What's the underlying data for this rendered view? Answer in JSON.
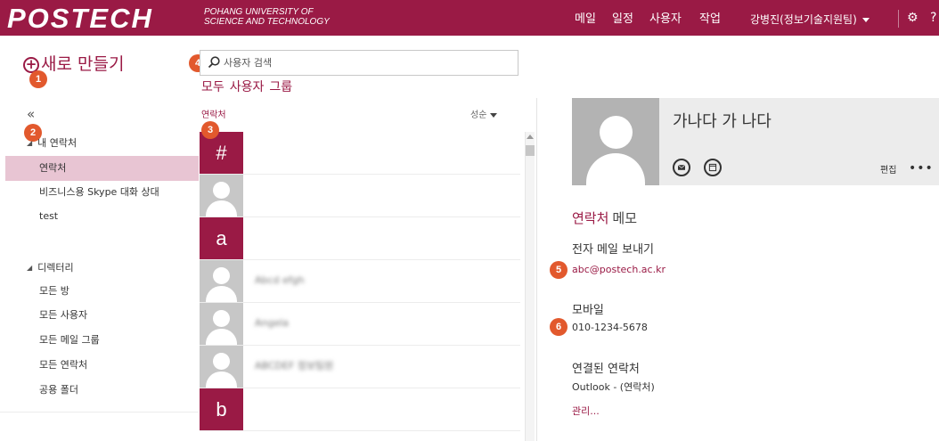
{
  "header": {
    "logo": "POSTECH",
    "logo_sub_line1": "POHANG UNIVERSITY OF",
    "logo_sub_line2": "SCIENCE AND TECHNOLOGY",
    "nav": [
      "메일",
      "일정",
      "사용자",
      "작업"
    ],
    "user": "강병진(정보기술지원팀)",
    "colors": {
      "brand": "#9a1a45"
    }
  },
  "left": {
    "new_button": "새로 만들기",
    "collapse_glyph": "«",
    "my_contacts_header": "내 연락처",
    "my_contacts": [
      "연락처",
      "비즈니스용 Skype 대화 상대",
      "test"
    ],
    "directory_header": "디렉터리",
    "directory": [
      "모든 방",
      "모든 사용자",
      "모든 메일 그룹",
      "모든 연락처",
      "공용 폴더"
    ]
  },
  "search": {
    "placeholder": "사용자 검색"
  },
  "filters": [
    "모두",
    "사용자",
    "그룹"
  ],
  "list": {
    "header": "연락처",
    "sort": "성순",
    "rows": [
      {
        "type": "letter",
        "text": "#"
      },
      {
        "type": "person",
        "name": ""
      },
      {
        "type": "letter",
        "text": "a"
      },
      {
        "type": "person",
        "name": "Abcd efgh"
      },
      {
        "type": "person",
        "name": "Angela"
      },
      {
        "type": "person",
        "name": "ABCDEF 정보팀원"
      },
      {
        "type": "letter",
        "text": "b"
      }
    ]
  },
  "detail": {
    "name": "가나다 가 나다",
    "edit": "편집",
    "more": "•••",
    "tabs": [
      "연락처",
      "메모"
    ],
    "email_label": "전자 메일 보내기",
    "email": "abc@postech.ac.kr",
    "mobile_label": "모바일",
    "mobile": "010-1234-5678",
    "linked_label": "연결된 연락처",
    "linked_value": "Outlook - (연락처)",
    "manage": "관리..."
  },
  "badges": [
    "1",
    "2",
    "3",
    "4",
    "5",
    "6"
  ]
}
